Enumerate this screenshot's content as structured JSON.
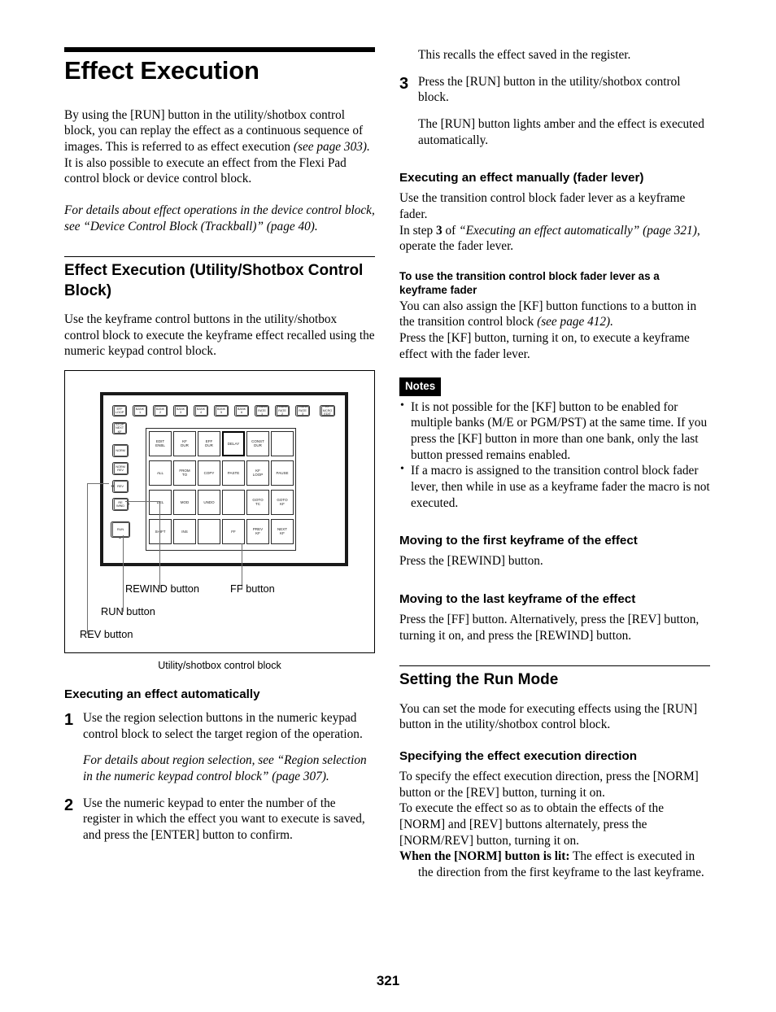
{
  "page": {
    "number": "321"
  },
  "left": {
    "title": "Effect Execution",
    "intro_p1": "By using the [RUN] button in the utility/shotbox control block, you can replay the effect as a continuous sequence of images. This is referred to as effect execution ",
    "intro_p1_italic": "(see page 303).",
    "intro_p2": "It is also possible to execute an effect from the Flexi Pad control block or device control block.",
    "intro_note": "For details about effect operations in the device control block, see “Device Control Block (Trackball)” (page 40).",
    "section_heading": "Effect Execution (Utility/Shotbox Control Block)",
    "section_body": "Use the keyframe control buttons in the utility/shotbox control block to execute the keyframe effect recalled using the numeric keypad control block.",
    "figure": {
      "caption": "Utility/shotbox control block",
      "callouts": [
        {
          "label": "REWIND button"
        },
        {
          "label": "FF button"
        },
        {
          "label": "RUN button"
        },
        {
          "label": "REV button"
        }
      ],
      "top_row_buttons": [
        "EFF\nLOOP",
        "BANK\n1",
        "BANK\n2",
        "BANK\n3",
        "BANK\n4",
        "BANK\n5",
        "BANK\n6",
        "TRANS\nRATE\n1",
        "TRANS\nRATE\n2",
        "TRANS\nRATE\n3",
        "KF\nMCRO\nEDIT"
      ],
      "left_column_buttons": [
        "STOP\nNEXT\nKF",
        "NORM",
        "NORM\nREV",
        "REV",
        "RE\nWIND",
        "RUN"
      ],
      "grid_buttons": [
        "EDIT\nENBL",
        "KF\nDUR",
        "EFF\nDUR",
        "DELAY",
        "CONST\nDUR",
        "",
        "ALL",
        "FROM\nTO",
        "COPY",
        "PASTE",
        "KF\nLOOP",
        "PAUSE",
        "DEL",
        "MOD",
        "UNDO",
        "",
        "GOTO\nTC",
        "GOTO\nKF",
        "SHIFT",
        "INS",
        "",
        "FF",
        "PREV\nKF",
        "NEXT\nKF"
      ]
    },
    "auto_heading": "Executing an effect automatically",
    "step1_num": "1",
    "step1_text": "Use the region selection buttons in the numeric keypad control block to select the target region of the operation.",
    "step1_note": "For details about region selection, see “Region selection in the numeric keypad control block” (page 307).",
    "step2_num": "2",
    "step2_text": "Use the numeric keypad to enter the number of the register in which the effect you want to execute is saved, and press the [ENTER] button to confirm."
  },
  "right": {
    "recall_text": "This recalls the effect saved in the register.",
    "step3_num": "3",
    "step3_text": "Press the [RUN] button in the utility/shotbox control block.",
    "step3_result": "The [RUN] button lights amber and the effect is executed automatically.",
    "manual_heading": "Executing an effect manually (fader lever)",
    "manual_p1": "Use the transition control block fader lever as a keyframe fader.",
    "manual_p2_a": "In step ",
    "manual_p2_num": "3",
    "manual_p2_b": " of ",
    "manual_p2_italic": "“Executing an effect automatically” (page 321)",
    "manual_p2_c": ", operate the fader lever.",
    "fader_heading": "To use the transition control block fader lever as a keyframe fader",
    "fader_p1_a": "You can also assign the [KF] button functions to a button in the transition control block ",
    "fader_p1_italic": "(see page 412).",
    "fader_p2": "Press the [KF] button, turning it on, to execute a keyframe effect with the fader lever.",
    "notes_badge": "Notes",
    "notes": [
      "It is not possible for the [KF] button to be enabled for multiple banks (M/E or PGM/PST) at the same time. If you press the [KF] button in more than one bank, only the last button pressed remains enabled.",
      "If a macro is assigned to the transition control block fader lever, then while in use as a keyframe fader the macro is not executed."
    ],
    "first_kf_heading": "Moving to the first keyframe of the effect",
    "first_kf_body": "Press the [REWIND] button.",
    "last_kf_heading": "Moving to the last keyframe of the effect",
    "last_kf_body": "Press the [FF] button. Alternatively, press the [REV] button, turning it on, and press the [REWIND] button.",
    "run_mode_heading": "Setting the Run Mode",
    "run_mode_body": "You can set the mode for executing effects using the [RUN] button in the utility/shotbox control block.",
    "direction_heading": "Specifying the effect execution direction",
    "direction_p1": "To specify the effect execution direction, press the [NORM] button or the [REV] button, turning it on.",
    "direction_p2": "To execute the effect so as to obtain the effects of the [NORM] and [REV] buttons alternately, press the [NORM/REV] button, turning it on.",
    "direction_p3_bold": "When the [NORM] button is lit:",
    "direction_p3_rest": " The effect is executed in the direction from the first keyframe to the last keyframe."
  }
}
